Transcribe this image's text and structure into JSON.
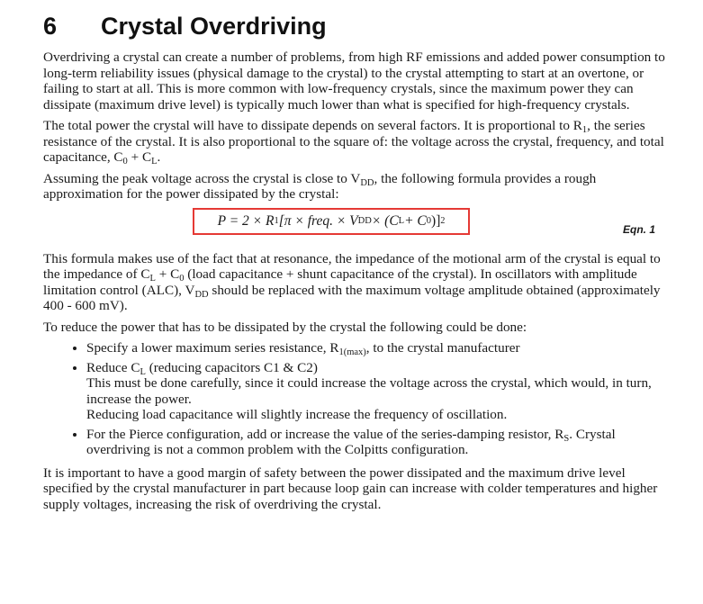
{
  "heading": {
    "number": "6",
    "title": "Crystal Overdriving"
  },
  "p1": "Overdriving a crystal can create a number of problems, from high RF emissions and added power consumption to long-term reliability issues (physical damage to the crystal) to the crystal attempting to start at an overtone, or failing to start at all. This is more common with low-frequency crystals, since the maximum power they can dissipate (maximum drive level) is typically much lower than what is specified for high-frequency crystals.",
  "p2": {
    "a": "The total power the crystal will have to dissipate depends on several factors. It is proportional to R",
    "s1": "1",
    "b": ", the series resistance of the crystal. It is also proportional to the square of: the voltage across the crystal, frequency, and total capacitance, C",
    "s2": "0",
    "c": " + C",
    "s3": "L",
    "d": "."
  },
  "p3": {
    "a": "Assuming the peak voltage across the crystal is close to V",
    "s1": "DD",
    "b": ", the following formula provides a rough approximation for the power dissipated by the crystal:"
  },
  "equation": {
    "lhs": "P = 2 × R",
    "r_sub": "1",
    "mid": " [π × freq. × V",
    "v_sub": "DD",
    "tail": " × (C",
    "cl_sub": "L",
    "plus": " + C",
    "c0_sub": "0",
    "close": ")]",
    "power": "2",
    "label": "Eqn. 1"
  },
  "p4": {
    "a": "This formula makes use of the fact that at resonance, the impedance of the motional arm of the crystal is equal to the impedance of C",
    "s1": "L",
    "b": " + C",
    "s2": "0",
    "c": " (load capacitance + shunt capacitance of the crystal). In oscillators with amplitude limitation control (ALC), V",
    "s3": "DD",
    "d": " should be replaced with the maximum voltage amplitude obtained (approximately 400 - 600 mV)."
  },
  "p5": "To reduce the power that has to be dissipated by the crystal the following could be done:",
  "bullets": {
    "b1": {
      "a": "Specify a lower maximum series resistance, R",
      "s1": "1(max)",
      "b": ", to the crystal manufacturer"
    },
    "b2": {
      "a": "Reduce C",
      "s1": "L",
      "b": " (reducing capacitors C1 & C2)",
      "line2": "This must be done carefully, since it could increase the voltage across the crystal, which would, in turn, increase the power.",
      "line3": "Reducing load capacitance will slightly increase the frequency of oscillation."
    },
    "b3": {
      "a": "For the Pierce configuration, add or increase the value of the series-damping resistor, R",
      "s1": "S",
      "b": ". Crystal overdriving is not a common problem with the Colpitts configuration."
    }
  },
  "p6": "It is important to have a good margin of safety between the power dissipated and the maximum drive level specified by the crystal manufacturer in part because loop gain can increase with colder temperatures and higher supply voltages, increasing the risk of overdriving the crystal.",
  "colors": {
    "equation_border": "#e53935",
    "text": "#1a1a1a"
  }
}
